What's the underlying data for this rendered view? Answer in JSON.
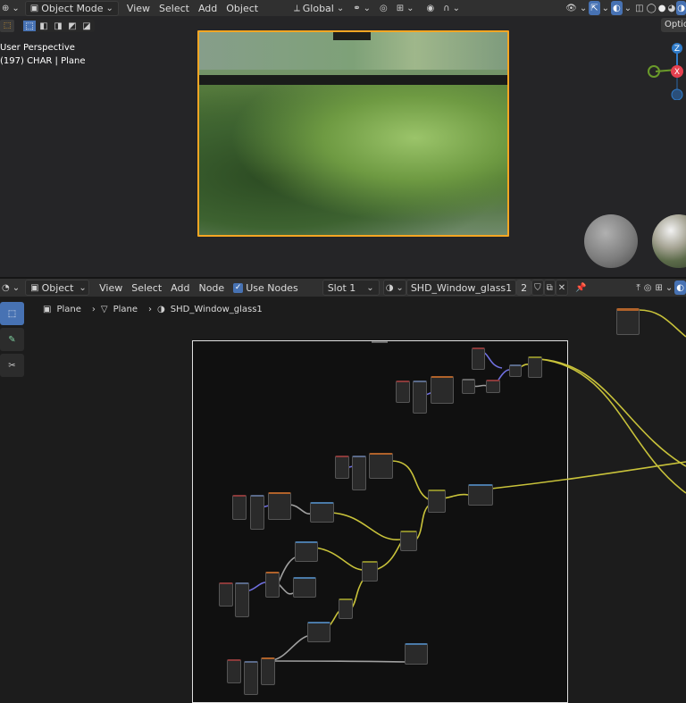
{
  "top_header": {
    "mode_label": "Object Mode",
    "menus": [
      "View",
      "Select",
      "Add",
      "Object"
    ],
    "transform_orientation": "Global"
  },
  "viewport": {
    "overlay_line1": "User Perspective",
    "overlay_line2": "(197) CHAR | Plane",
    "options_label": "Optio",
    "gizmo": {
      "z": "Z",
      "x": "X"
    },
    "colors": {
      "selection_outline": "#f5a623",
      "gizmo_x": "#e5404f",
      "gizmo_y": "#6a9a2a",
      "gizmo_z": "#2f7bc9"
    }
  },
  "node_header": {
    "editor_type": "Object",
    "menus": [
      "View",
      "Select",
      "Add",
      "Node"
    ],
    "use_nodes_label": "Use Nodes",
    "slot_label": "Slot 1",
    "material_name": "SHD_Window_glass1",
    "user_count": "2"
  },
  "breadcrumb": {
    "items": [
      "Plane",
      "Plane",
      "SHD_Window_glass1"
    ]
  },
  "tools": [
    "select-tool",
    "annotate-tool",
    "cut-links-tool"
  ],
  "colors": {
    "node_link_yellow": "#c8c23a",
    "node_link_purple": "#7070e0",
    "node_link_grey": "#a0a0a0"
  }
}
